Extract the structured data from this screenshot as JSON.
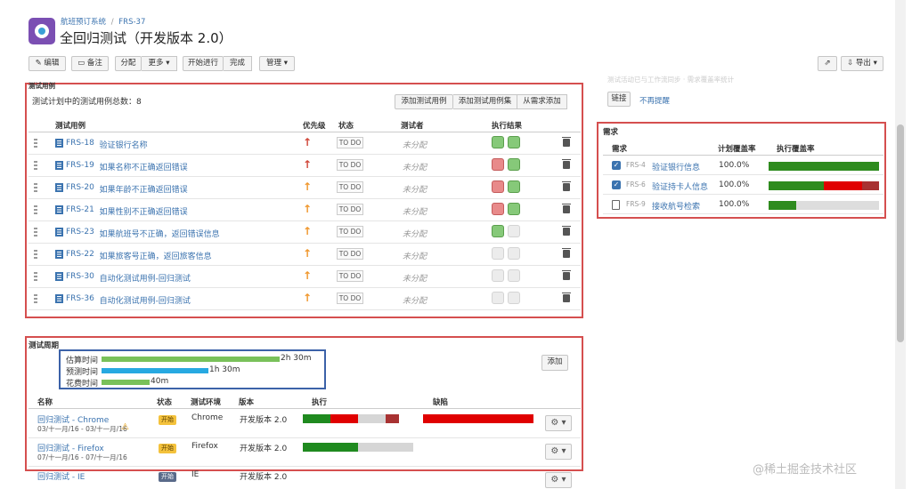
{
  "header": {
    "breadcrumb_project": "航班预订系统",
    "breadcrumb_sep": "/",
    "breadcrumb_issue": "FRS-37",
    "title": "全回归测试（开发版本 2.0）"
  },
  "toolbar": {
    "edit": "编辑",
    "comment": "备注",
    "assign": "分配",
    "more": "更多",
    "start": "开始进行",
    "done": "完成",
    "manage": "管理",
    "export": "导出"
  },
  "right_top": {
    "faded_text": "测试活动已与工作流同步 · 需求覆盖率统计",
    "link_btn": "链接",
    "no_remind": "不再提醒"
  },
  "testcases": {
    "section_title": "测试用例",
    "count_text": "测试计划中的测试用例总数：8",
    "add_case": "添加测试用例",
    "add_set": "添加测试用例集",
    "add_from_req": "从需求添加",
    "columns": {
      "case": "测试用例",
      "priority": "优先级",
      "status": "状态",
      "tester": "测试者",
      "result": "执行结果"
    },
    "rows": [
      {
        "key": "FRS-18",
        "name": "验证银行名称",
        "priority": "high",
        "status": "TO DO",
        "tester": "未分配",
        "r1": "g",
        "r2": "g"
      },
      {
        "key": "FRS-19",
        "name": "如果名称不正确返回错误",
        "priority": "high",
        "status": "TO DO",
        "tester": "未分配",
        "r1": "r",
        "r2": "g"
      },
      {
        "key": "FRS-20",
        "name": "如果年龄不正确返回错误",
        "priority": "medium",
        "status": "TO DO",
        "tester": "未分配",
        "r1": "r",
        "r2": "g"
      },
      {
        "key": "FRS-21",
        "name": "如果性别不正确返回错误",
        "priority": "medium",
        "status": "TO DO",
        "tester": "未分配",
        "r1": "r",
        "r2": "g"
      },
      {
        "key": "FRS-23",
        "name": "如果航班号不正确，返回错误信息",
        "priority": "medium",
        "status": "TO DO",
        "tester": "未分配",
        "r1": "g",
        "r2": "e"
      },
      {
        "key": "FRS-22",
        "name": "如果旅客号正确，返回旅客信息",
        "priority": "medium",
        "status": "TO DO",
        "tester": "未分配",
        "r1": "e",
        "r2": "e"
      },
      {
        "key": "FRS-30",
        "name": "自动化测试用例-回归测试",
        "priority": "medium",
        "status": "TO DO",
        "tester": "未分配",
        "r1": "e",
        "r2": "e"
      },
      {
        "key": "FRS-36",
        "name": "自动化测试用例-回归测试",
        "priority": "medium",
        "status": "TO DO",
        "tester": "未分配",
        "r1": "e",
        "r2": "e"
      }
    ]
  },
  "requirements": {
    "section_title": "需求",
    "col_req": "需求",
    "col_plan": "计划覆盖率",
    "col_exec": "执行覆盖率",
    "rows": [
      {
        "key": "FRS-4",
        "name": "验证银行信息",
        "plan": "100.0%",
        "icon": "check",
        "exec": [
          {
            "c": "#2e8b1e",
            "w": 1
          }
        ]
      },
      {
        "key": "FRS-6",
        "name": "验证持卡人信息",
        "plan": "100.0%",
        "icon": "check",
        "exec": [
          {
            "c": "#2e8b1e",
            "w": 0.5
          },
          {
            "c": "#e00000",
            "w": 0.35
          },
          {
            "c": "#a83232",
            "w": 0.15
          }
        ]
      },
      {
        "key": "FRS-9",
        "name": "接收航号检索",
        "plan": "100.0%",
        "icon": "doc",
        "exec": [
          {
            "c": "#2e8b1e",
            "w": 0.25
          },
          {
            "c": "#dddddd",
            "w": 0.75
          }
        ]
      }
    ]
  },
  "cycles": {
    "section_title": "测试周期",
    "add": "添加",
    "estimate_label": "估算时间",
    "estimate_value": "2h 30m",
    "estimate_fraction": 1.0,
    "forecast_label": "预测时间",
    "forecast_value": "1h 30m",
    "forecast_fraction": 0.6,
    "spent_label": "花费时间",
    "spent_value": "40m",
    "spent_fraction": 0.27,
    "columns": {
      "name": "名称",
      "status": "状态",
      "env": "测试环境",
      "version": "版本",
      "exec": "执行",
      "defects": "缺陷"
    },
    "rows": [
      {
        "name": "回归测试 - Chrome",
        "dates": "03/十一月/16 - 03/十一月/16",
        "status": "开始",
        "env": "Chrome",
        "version": "开发版本 2.0",
        "warn": true,
        "exec": [
          {
            "c": "#1f8a1f",
            "w": 0.25
          },
          {
            "c": "#e00000",
            "w": 0.25
          },
          {
            "c": "#d6d6d6",
            "w": 0.25
          },
          {
            "c": "#a83232",
            "w": 0.12
          }
        ],
        "defects": [
          {
            "c": "#e00000",
            "w": 1
          }
        ]
      },
      {
        "name": "回归测试 - Firefox",
        "dates": "07/十一月/16 - 07/十一月/16",
        "status": "开始",
        "env": "Firefox",
        "version": "开发版本 2.0",
        "warn": false,
        "exec": [
          {
            "c": "#1f8a1f",
            "w": 0.5
          },
          {
            "c": "#d6d6d6",
            "w": 0.5
          }
        ],
        "defects": []
      },
      {
        "name": "回归测试 - IE",
        "dates": "",
        "status": "开始",
        "env": "IE",
        "version": "开发版本 2.0",
        "warn": false,
        "exec": [],
        "defects": []
      }
    ]
  },
  "watermark": "@稀土掘金技术社区",
  "colors": {
    "link": "#3b73af",
    "red_box": "#d54f4f",
    "high": "#d04437",
    "medium": "#f0962a"
  }
}
